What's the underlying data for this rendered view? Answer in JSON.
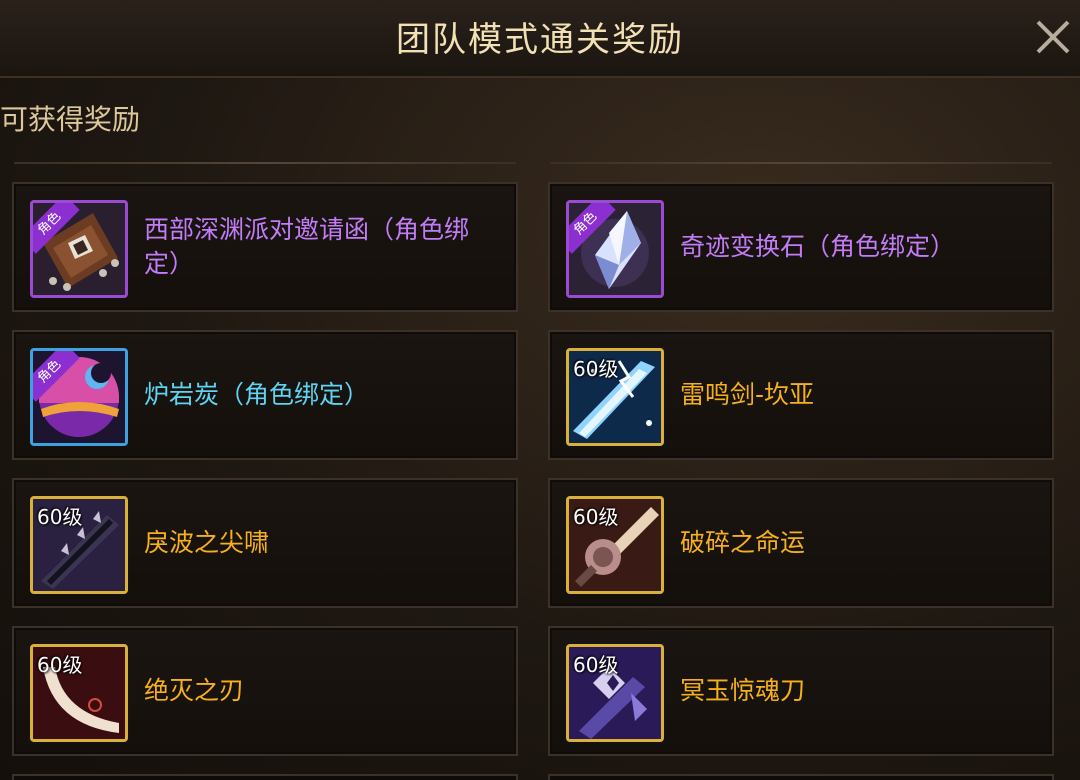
{
  "header": {
    "title": "团队模式通关奖励"
  },
  "section": {
    "label": "可获得奖励"
  },
  "rewards": [
    {
      "name": "西部深渊派对邀请函（角色绑定）",
      "tag": "角色",
      "rarity": "purple",
      "icon": "invitation-icon"
    },
    {
      "name": "奇迹变换石（角色绑定）",
      "tag": "角色",
      "rarity": "purple",
      "icon": "crystal-icon"
    },
    {
      "name": "炉岩炭（角色绑定）",
      "tag": "角色",
      "rarity": "blue",
      "icon": "lava-orb-icon"
    },
    {
      "name": "雷鸣剑-坎亚",
      "level": "60级",
      "rarity": "gold",
      "icon": "lightning-sword-icon"
    },
    {
      "name": "戾波之尖啸",
      "level": "60级",
      "rarity": "gold",
      "icon": "dark-blade-icon"
    },
    {
      "name": "破碎之命运",
      "level": "60级",
      "rarity": "gold",
      "icon": "broken-sword-icon"
    },
    {
      "name": "绝灭之刃",
      "level": "60级",
      "rarity": "gold",
      "icon": "curved-blade-icon"
    },
    {
      "name": "冥玉惊魂刀",
      "level": "60级",
      "rarity": "gold",
      "icon": "spectral-blade-icon"
    }
  ],
  "colors": {
    "purple": "#c17cf6",
    "blue": "#5fd3f1",
    "gold": "#f5b01c"
  }
}
